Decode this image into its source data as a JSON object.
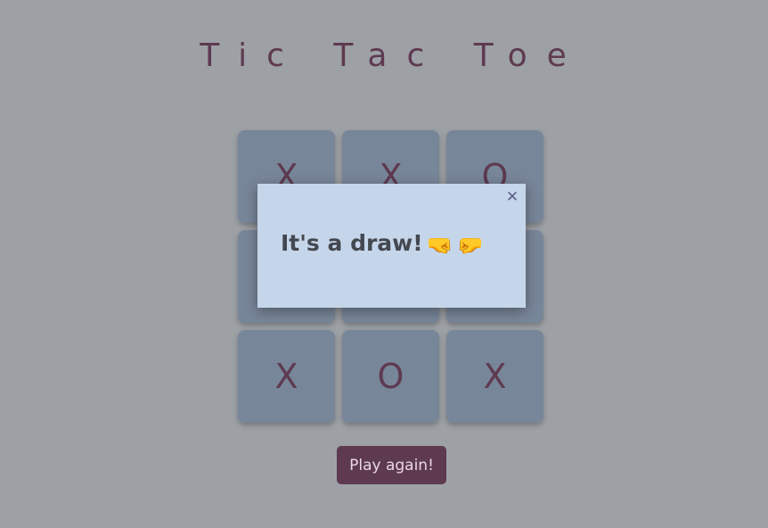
{
  "title": "Tic Tac Toe",
  "board": {
    "cells": [
      "X",
      "X",
      "O",
      "",
      "",
      "",
      "X",
      "O",
      "X"
    ]
  },
  "play_again_label": "Play again!",
  "modal": {
    "close_label": "✕",
    "message": "It's a draw!",
    "emoji_left": "🤜",
    "emoji_right": "🤛"
  }
}
